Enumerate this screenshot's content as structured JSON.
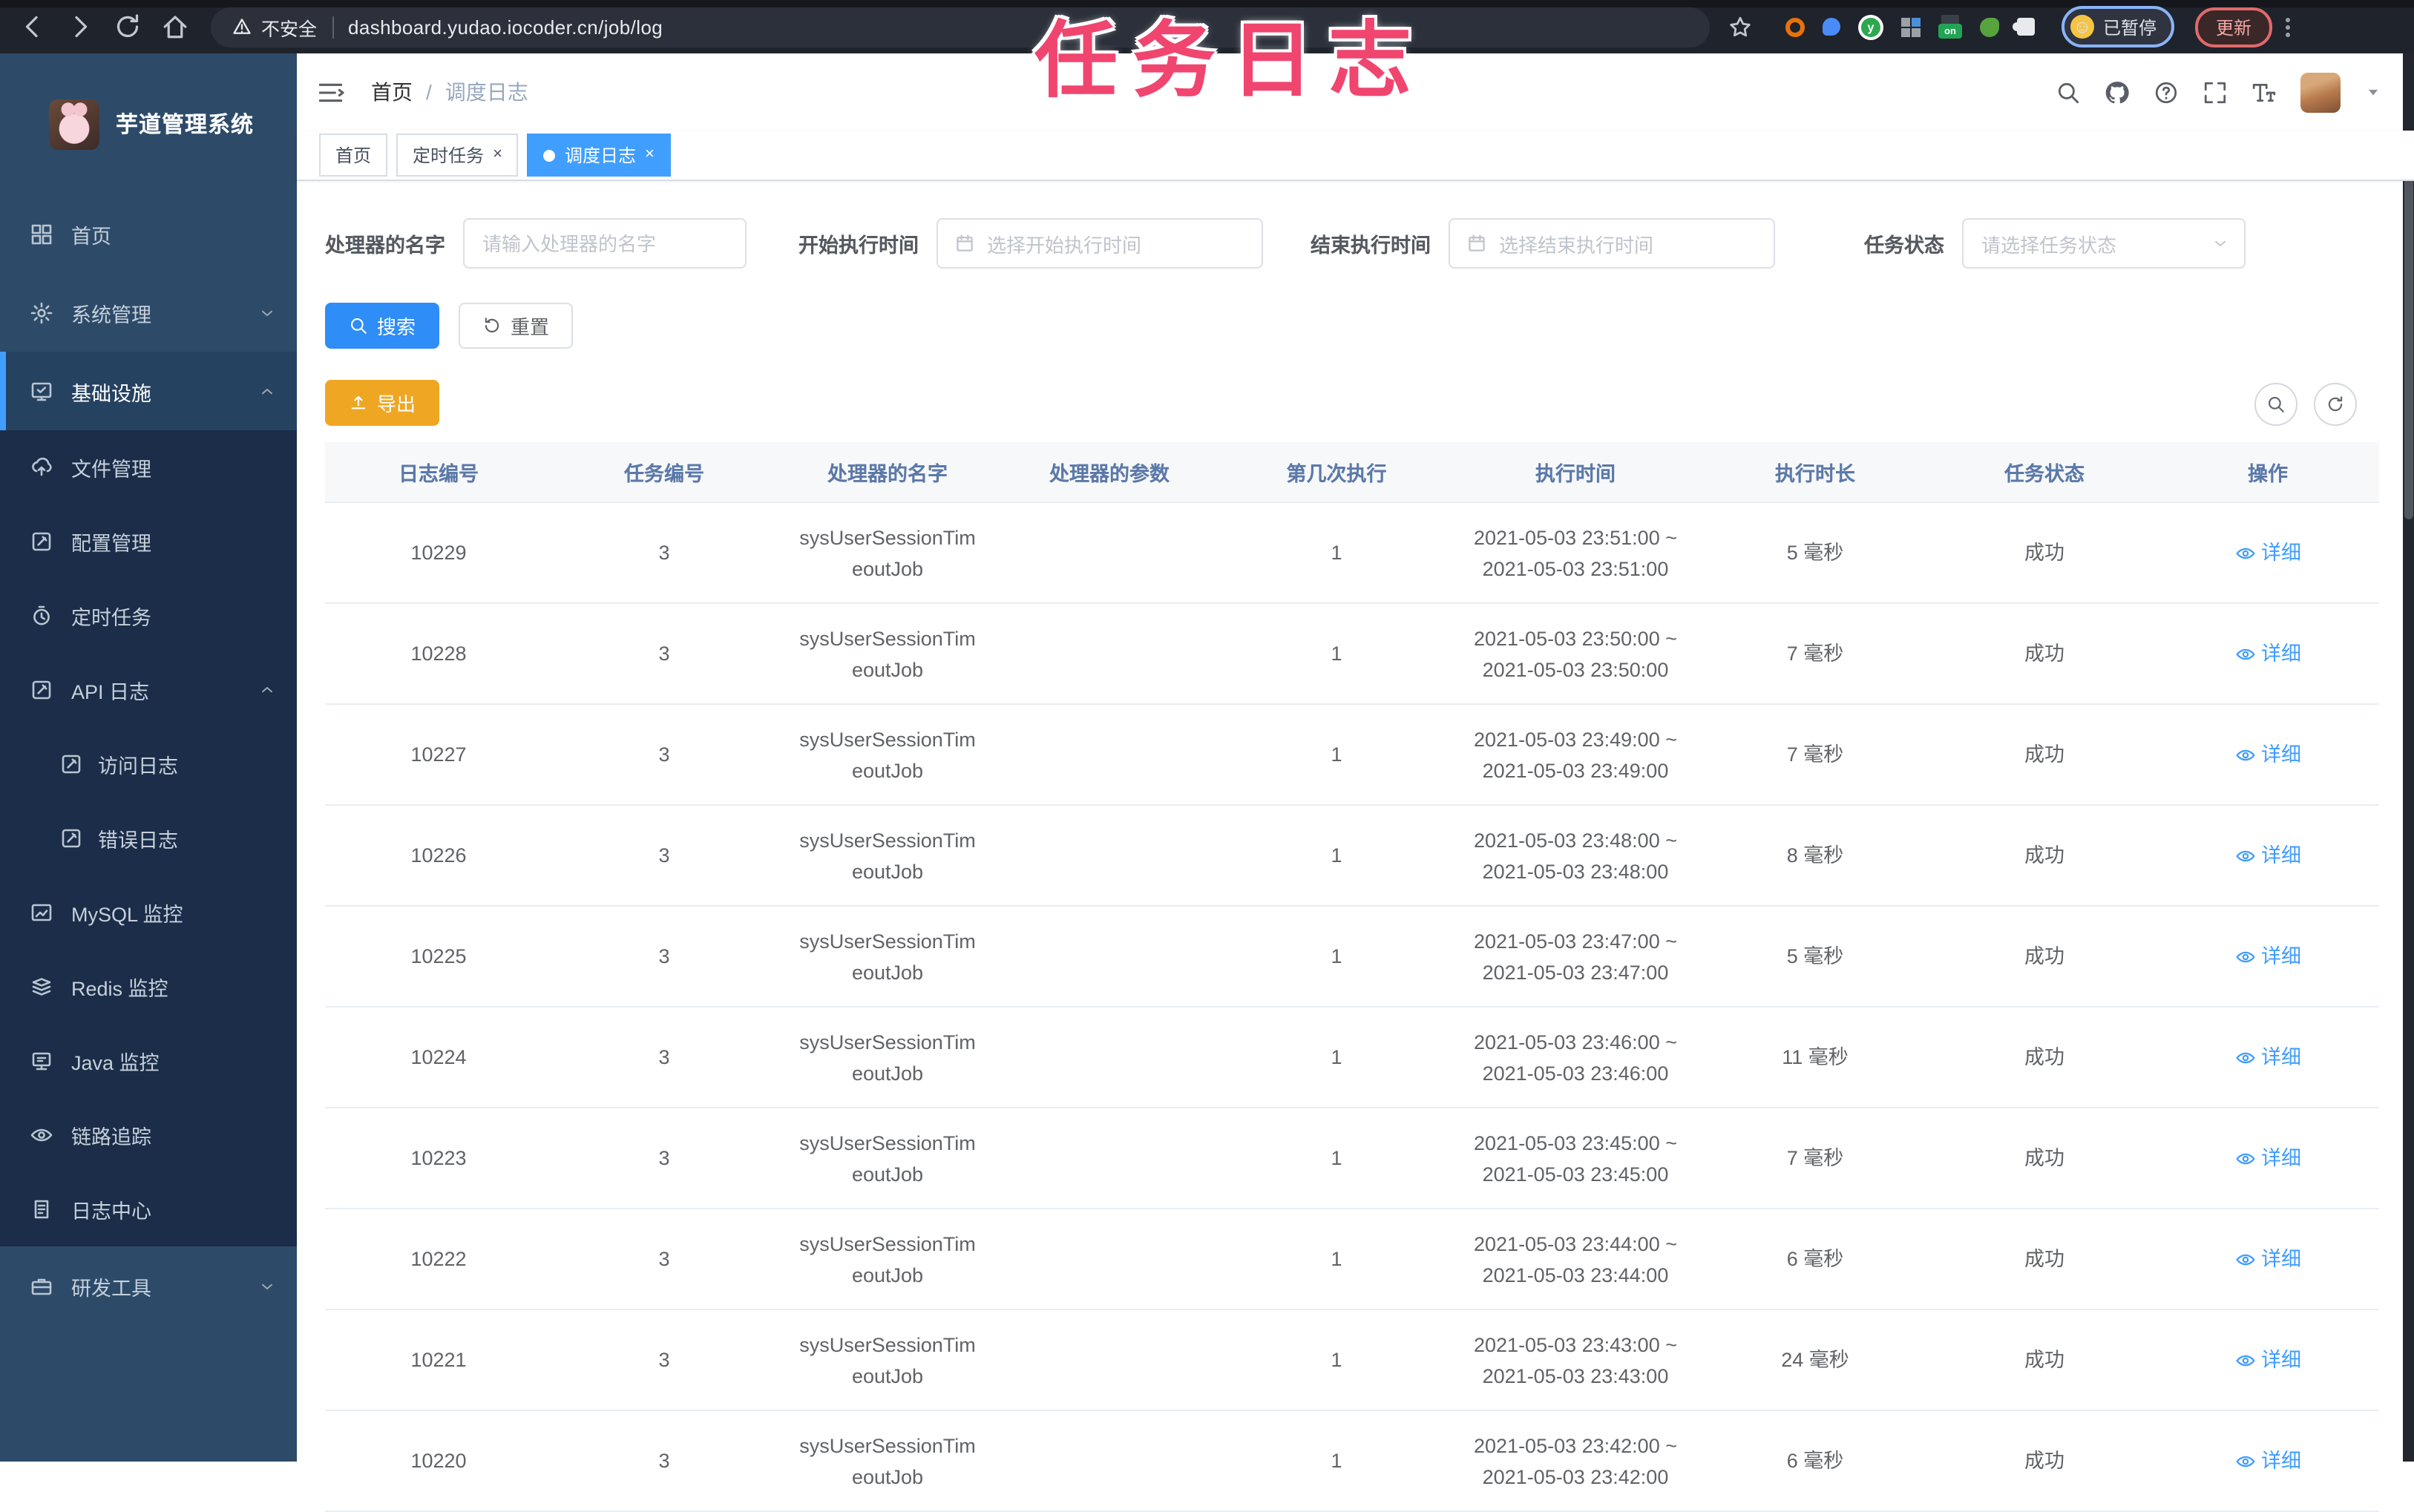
{
  "browser": {
    "security_label": "不安全",
    "url": "dashboard.yudao.iocoder.cn/job/log",
    "extension_on_badge": "on",
    "extension_y_letter": "y",
    "profile_face": "☺",
    "profile_badge": "已暂停",
    "update_button": "更新"
  },
  "annotation": {
    "text": "任务日志",
    "color": "#f0456f"
  },
  "sidebar": {
    "app_title": "芋道管理系统",
    "items": [
      {
        "label": "首页",
        "icon": "dashboard",
        "level": 1
      },
      {
        "label": "系统管理",
        "icon": "gear",
        "level": 1,
        "arrow": "down"
      },
      {
        "label": "基础设施",
        "icon": "infra",
        "level": 1,
        "arrow": "up",
        "active": true
      },
      {
        "label": "文件管理",
        "icon": "upload",
        "level": 2
      },
      {
        "label": "配置管理",
        "icon": "edit",
        "level": 2
      },
      {
        "label": "定时任务",
        "icon": "timer",
        "level": 2
      },
      {
        "label": "API 日志",
        "icon": "edit",
        "level": 2,
        "arrow": "up"
      },
      {
        "label": "访问日志",
        "icon": "edit",
        "level": 3
      },
      {
        "label": "错误日志",
        "icon": "edit",
        "level": 3
      },
      {
        "label": "MySQL 监控",
        "icon": "mysql",
        "level": 2
      },
      {
        "label": "Redis 监控",
        "icon": "redis",
        "level": 2
      },
      {
        "label": "Java 监控",
        "icon": "java",
        "level": 2
      },
      {
        "label": "链路追踪",
        "icon": "eye",
        "level": 2
      },
      {
        "label": "日志中心",
        "icon": "logc",
        "level": 2
      },
      {
        "label": "研发工具",
        "icon": "toolbox",
        "level": 1,
        "arrow": "down"
      }
    ]
  },
  "header": {
    "breadcrumb": {
      "home": "首页",
      "separator": "/",
      "current": "调度日志"
    }
  },
  "tabs": [
    {
      "label": "首页",
      "active": false,
      "closable": false
    },
    {
      "label": "定时任务",
      "active": false,
      "closable": true
    },
    {
      "label": "调度日志",
      "active": true,
      "closable": true
    }
  ],
  "filters": {
    "handler_name": {
      "label": "处理器的名字",
      "placeholder": "请输入处理器的名字"
    },
    "begin_time": {
      "label": "开始执行时间",
      "placeholder": "选择开始执行时间"
    },
    "end_time": {
      "label": "结束执行时间",
      "placeholder": "选择结束执行时间"
    },
    "status": {
      "label": "任务状态",
      "placeholder": "请选择任务状态"
    }
  },
  "actions": {
    "search": "搜索",
    "reset": "重置",
    "export": "导出"
  },
  "table": {
    "columns": [
      "日志编号",
      "任务编号",
      "处理器的名字",
      "处理器的参数",
      "第几次执行",
      "执行时间",
      "执行时长",
      "任务状态",
      "操作"
    ],
    "action_label": "详细",
    "rows": [
      {
        "id": "10229",
        "task": "3",
        "handler": [
          "sysUserSessionTim",
          "eoutJob"
        ],
        "param": "",
        "count": "1",
        "time": [
          "2021-05-03 23:51:00 ~",
          "2021-05-03 23:51:00"
        ],
        "duration": "5 毫秒",
        "status": "成功"
      },
      {
        "id": "10228",
        "task": "3",
        "handler": [
          "sysUserSessionTim",
          "eoutJob"
        ],
        "param": "",
        "count": "1",
        "time": [
          "2021-05-03 23:50:00 ~",
          "2021-05-03 23:50:00"
        ],
        "duration": "7 毫秒",
        "status": "成功"
      },
      {
        "id": "10227",
        "task": "3",
        "handler": [
          "sysUserSessionTim",
          "eoutJob"
        ],
        "param": "",
        "count": "1",
        "time": [
          "2021-05-03 23:49:00 ~",
          "2021-05-03 23:49:00"
        ],
        "duration": "7 毫秒",
        "status": "成功"
      },
      {
        "id": "10226",
        "task": "3",
        "handler": [
          "sysUserSessionTim",
          "eoutJob"
        ],
        "param": "",
        "count": "1",
        "time": [
          "2021-05-03 23:48:00 ~",
          "2021-05-03 23:48:00"
        ],
        "duration": "8 毫秒",
        "status": "成功"
      },
      {
        "id": "10225",
        "task": "3",
        "handler": [
          "sysUserSessionTim",
          "eoutJob"
        ],
        "param": "",
        "count": "1",
        "time": [
          "2021-05-03 23:47:00 ~",
          "2021-05-03 23:47:00"
        ],
        "duration": "5 毫秒",
        "status": "成功"
      },
      {
        "id": "10224",
        "task": "3",
        "handler": [
          "sysUserSessionTim",
          "eoutJob"
        ],
        "param": "",
        "count": "1",
        "time": [
          "2021-05-03 23:46:00 ~",
          "2021-05-03 23:46:00"
        ],
        "duration": "11 毫秒",
        "status": "成功"
      },
      {
        "id": "10223",
        "task": "3",
        "handler": [
          "sysUserSessionTim",
          "eoutJob"
        ],
        "param": "",
        "count": "1",
        "time": [
          "2021-05-03 23:45:00 ~",
          "2021-05-03 23:45:00"
        ],
        "duration": "7 毫秒",
        "status": "成功"
      },
      {
        "id": "10222",
        "task": "3",
        "handler": [
          "sysUserSessionTim",
          "eoutJob"
        ],
        "param": "",
        "count": "1",
        "time": [
          "2021-05-03 23:44:00 ~",
          "2021-05-03 23:44:00"
        ],
        "duration": "6 毫秒",
        "status": "成功"
      },
      {
        "id": "10221",
        "task": "3",
        "handler": [
          "sysUserSessionTim",
          "eoutJob"
        ],
        "param": "",
        "count": "1",
        "time": [
          "2021-05-03 23:43:00 ~",
          "2021-05-03 23:43:00"
        ],
        "duration": "24 毫秒",
        "status": "成功"
      },
      {
        "id": "10220",
        "task": "3",
        "handler": [
          "sysUserSessionTim",
          "eoutJob"
        ],
        "param": "",
        "count": "1",
        "time": [
          "2021-05-03 23:42:00 ~",
          "2021-05-03 23:42:00"
        ],
        "duration": "6 毫秒",
        "status": "成功"
      }
    ]
  }
}
